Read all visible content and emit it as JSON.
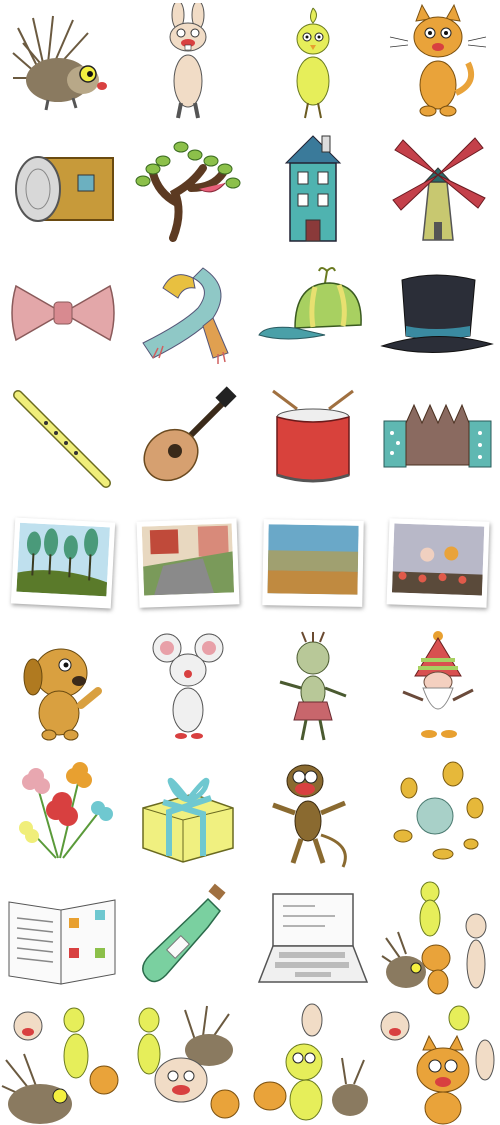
{
  "sprite_sheet": {
    "rows": [
      {
        "icons": [
          "hedgehog-icon",
          "rabbit-icon",
          "chick-icon",
          "cat-icon"
        ]
      },
      {
        "icons": [
          "log-icon",
          "tree-icon",
          "house-icon",
          "windmill-icon"
        ]
      },
      {
        "icons": [
          "bow-tie-icon",
          "scarf-icon",
          "cap-icon",
          "top-hat-icon"
        ]
      },
      {
        "icons": [
          "recorder-flute-icon",
          "guitar-icon",
          "drum-icon",
          "accordion-icon"
        ]
      },
      {
        "icons": [
          "forest-photo-icon",
          "street-photo-icon",
          "field-photo-icon",
          "stage-photo-icon"
        ]
      },
      {
        "icons": [
          "dog-icon",
          "mouse-icon",
          "troll-girl-icon",
          "gnome-icon"
        ]
      },
      {
        "icons": [
          "flowers-icon",
          "gift-box-icon",
          "monkey-icon",
          "coins-icon"
        ]
      },
      {
        "icons": [
          "book-icon",
          "bottle-message-icon",
          "laptop-icon",
          "animal-group-icon"
        ]
      },
      {
        "icons": [
          "animal-group-icon",
          "animal-group-icon",
          "animal-group-icon",
          "animal-group-icon"
        ]
      }
    ],
    "colors": {
      "hedgehog": "#8a7a60",
      "rabbit": "#f1dcc6",
      "chick": "#e6ee5a",
      "cat": "#e9a33a",
      "log": "#c79a3a",
      "tree": "#5c3a22",
      "leaf": "#8cc04a",
      "house": "#4fb3b0",
      "windmill_sail": "#c4404a",
      "windmill_body": "#c8c870",
      "bow": "#e3a7a9",
      "scarf": "#8fc8c6",
      "cap": "#a8d061",
      "hat": "#2b2e38",
      "flute": "#f0ee7a",
      "guitar": "#d6a070",
      "drum": "#d8423c",
      "accordion": "#5fb8b2",
      "dog": "#d9a040",
      "mouse": "#f0f0f0",
      "troll_skirt": "#c8666c",
      "gnome_hat": "#d85050",
      "gift": "#f0f080",
      "ribbon": "#6fc8d0",
      "monkey": "#8a6a30",
      "coin": "#e6b83a",
      "bottle": "#7ad0a0"
    }
  }
}
